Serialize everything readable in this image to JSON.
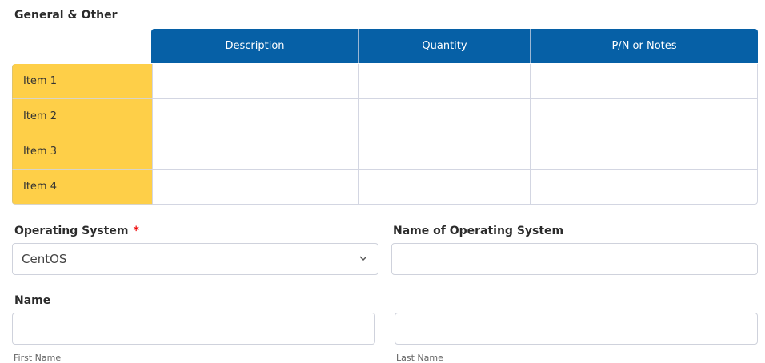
{
  "section_title": "General & Other",
  "table": {
    "headers": [
      "Description",
      "Quantity",
      "P/N or Notes"
    ],
    "rows": [
      {
        "label": "Item 1",
        "description": "",
        "quantity": "",
        "notes": ""
      },
      {
        "label": "Item 2",
        "description": "",
        "quantity": "",
        "notes": ""
      },
      {
        "label": "Item 3",
        "description": "",
        "quantity": "",
        "notes": ""
      },
      {
        "label": "Item 4",
        "description": "",
        "quantity": "",
        "notes": ""
      }
    ],
    "header_color": "#0660a6",
    "row_label_color": "#fecf48"
  },
  "operating_system": {
    "label": "Operating System",
    "required_mark": "*",
    "value": "CentOS",
    "icon": "chevron-down-icon"
  },
  "os_name": {
    "label": "Name of Operating System",
    "value": ""
  },
  "name": {
    "label": "Name",
    "first_label": "First Name",
    "last_label": "Last Name",
    "first_value": "",
    "last_value": ""
  }
}
